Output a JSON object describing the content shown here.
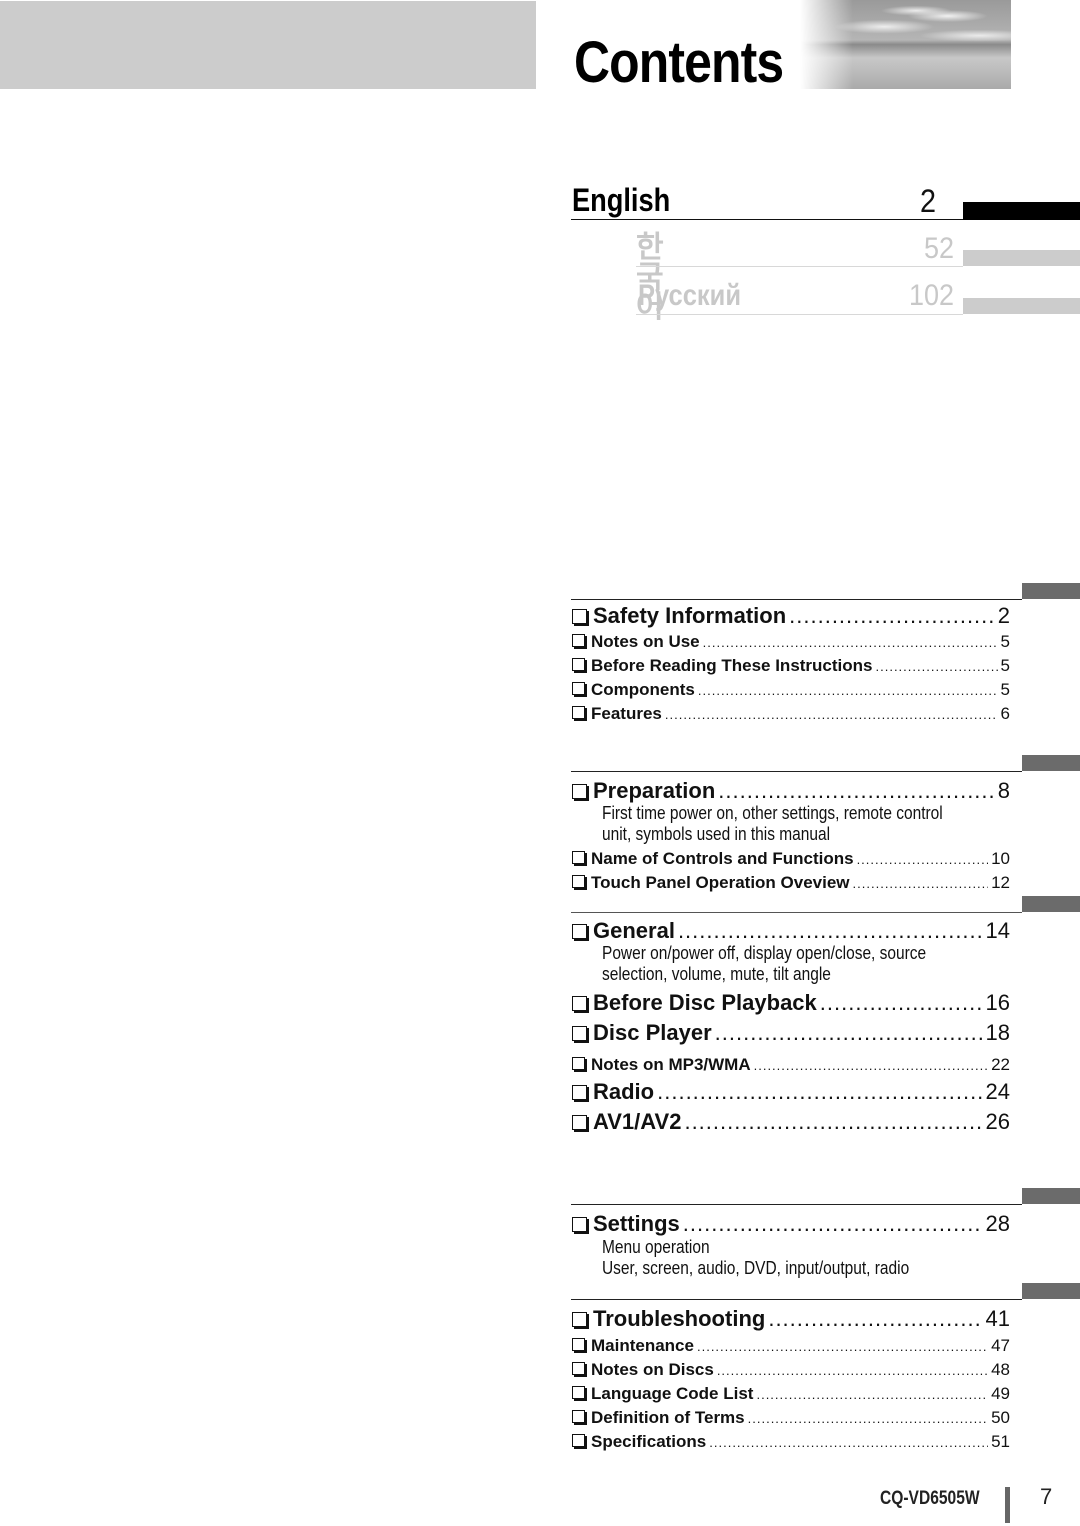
{
  "header": {
    "title": "Contents"
  },
  "languages": [
    {
      "name": "English",
      "page": "2",
      "active": true
    },
    {
      "name": "한국어",
      "page": "52",
      "active": false
    },
    {
      "name": "Русский",
      "page": "102",
      "active": false
    }
  ],
  "toc": {
    "safety": {
      "title": "Safety Information",
      "page": "2"
    },
    "notes_on_use": {
      "title": "Notes on Use",
      "page": "5"
    },
    "before_reading": {
      "title": "Before Reading These Instructions",
      "page": "5"
    },
    "components": {
      "title": "Components",
      "page": "5"
    },
    "features": {
      "title": "Features",
      "page": "6"
    },
    "preparation": {
      "title": "Preparation",
      "page": "8",
      "desc": [
        "First time power on, other settings, remote control",
        "unit, symbols used in this manual"
      ]
    },
    "name_controls": {
      "title": "Name of Controls and Functions",
      "page": "10"
    },
    "touch_panel": {
      "title": "Touch Panel Operation Oveview",
      "page": "12"
    },
    "general": {
      "title": "General",
      "page": "14",
      "desc": [
        "Power on/power off, display open/close, source",
        "selection, volume, mute, tilt angle"
      ]
    },
    "before_disc": {
      "title": "Before Disc Playback",
      "page": "16"
    },
    "disc_player": {
      "title": "Disc Player",
      "page": "18"
    },
    "notes_mp3": {
      "title": "Notes on MP3/WMA",
      "page": "22"
    },
    "radio": {
      "title": "Radio",
      "page": "24"
    },
    "av": {
      "title": "AV1/AV2",
      "page": "26"
    },
    "settings": {
      "title": "Settings",
      "page": "28",
      "desc": [
        "Menu operation",
        "User, screen, audio, DVD, input/output, radio"
      ]
    },
    "troubleshooting": {
      "title": "Troubleshooting",
      "page": "41"
    },
    "maintenance": {
      "title": "Maintenance",
      "page": "47"
    },
    "notes_discs": {
      "title": "Notes on Discs",
      "page": "48"
    },
    "language_code": {
      "title": "Language Code List",
      "page": "49"
    },
    "definition_terms": {
      "title": "Definition of Terms",
      "page": "50"
    },
    "specifications": {
      "title": "Specifications",
      "page": "51"
    }
  },
  "footer": {
    "model": "CQ-VD6505W",
    "page_number": "7"
  },
  "colors": {
    "active_tab": "#000000",
    "inactive_tab": "#cccccc",
    "section_tab": "#6b6b6b",
    "inactive_text": "#c8c8c8"
  }
}
